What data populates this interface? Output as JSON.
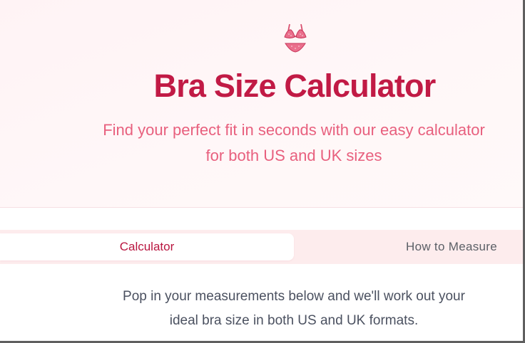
{
  "hero": {
    "icon": "bikini-icon",
    "title": "Bra Size Calculator",
    "subtitle_line1": "Find your perfect fit in seconds with our easy calculator",
    "subtitle_line2": "for both US and UK sizes"
  },
  "tabs": [
    {
      "label": "Calculator",
      "active": true
    },
    {
      "label": "How to Measure",
      "active": false
    }
  ],
  "intro": {
    "line1": "Pop in your measurements below and we'll work out your",
    "line2": "ideal bra size in both US and UK formats."
  },
  "colors": {
    "accent": "#c11a45",
    "subtitle": "#e8607e",
    "tab_bar": "#fdeced",
    "body_text": "#4b5160"
  }
}
